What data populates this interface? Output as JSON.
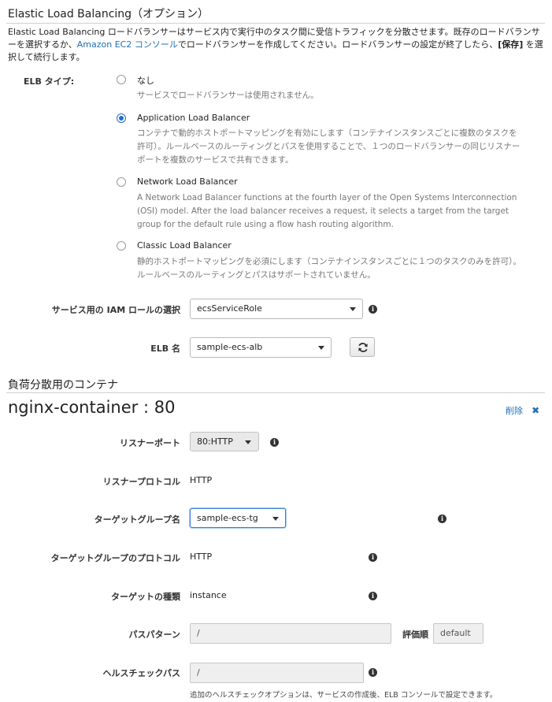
{
  "elb_section": {
    "title": "Elastic Load Balancing（オプション）",
    "intro_1": "Elastic Load Balancing ロードバランサーはサービス内で実行中のタスク間に受信トラフィックを分散させます。既存のロードバランサーを選択するか、",
    "intro_link": "Amazon EC2 コンソール",
    "intro_2": "でロードバランサーを作成してください。ロードバランサーの設定が終了したら、",
    "intro_save": "[保存]",
    "intro_3": " を選択して続行します。",
    "type_label": "ELB タイプ:",
    "options": [
      {
        "title": "なし",
        "desc": "サービスでロードバランサーは使用されません。",
        "selected": false
      },
      {
        "title": "Application Load Balancer",
        "desc": "コンテナで動的ホストポートマッピングを有効にします（コンテナインスタンスごとに複数のタスクを許可）。ルールベースのルーティングとパスを使用することで、１つのロードバランサーの同じリスナーポートを複数のサービスで共有できます。",
        "selected": true
      },
      {
        "title": "Network Load Balancer",
        "desc": "A Network Load Balancer functions at the fourth layer of the Open Systems Interconnection (OSI) model. After the load balancer receives a request, it selects a target from the target group for the default rule using a flow hash routing algorithm.",
        "selected": false
      },
      {
        "title": "Classic Load Balancer",
        "desc": "静的ホストポートマッピングを必須にします（コンテナインスタンスごとに１つのタスクのみを許可）。ルールベースのルーティングとパスはサポートされていません。",
        "selected": false
      }
    ],
    "iam_label": "サービス用の IAM ロールの選択",
    "iam_value": "ecsServiceRole",
    "elb_name_label": "ELB 名",
    "elb_name_value": "sample-ecs-alb"
  },
  "container_section": {
    "title": "負荷分散用のコンテナ",
    "container_name": "nginx-container : 80",
    "delete_label": "削除",
    "listener_port_label": "リスナーポート",
    "listener_port_value": "80:HTTP",
    "listener_protocol_label": "リスナープロトコル",
    "listener_protocol_value": "HTTP",
    "target_group_label": "ターゲットグループ名",
    "target_group_value": "sample-ecs-tg",
    "target_protocol_label": "ターゲットグループのプロトコル",
    "target_protocol_value": "HTTP",
    "target_type_label": "ターゲットの種類",
    "target_type_value": "instance",
    "path_pattern_label": "パスパターン",
    "path_pattern_value": "/",
    "eval_order_label": "評価順",
    "eval_order_value": "default",
    "health_path_label": "ヘルスチェックパス",
    "health_path_value": "/",
    "health_hint": "追加のヘルスチェックオプションは、サービスの作成後、ELB コンソールで設定できます。"
  },
  "icons": {
    "info": "info-icon",
    "refresh": "refresh-icon",
    "delete": "close-icon",
    "dropdown": "caret-down-icon"
  },
  "colors": {
    "link": "#1f6fb5",
    "radio_selected": "#1f6fd0"
  }
}
